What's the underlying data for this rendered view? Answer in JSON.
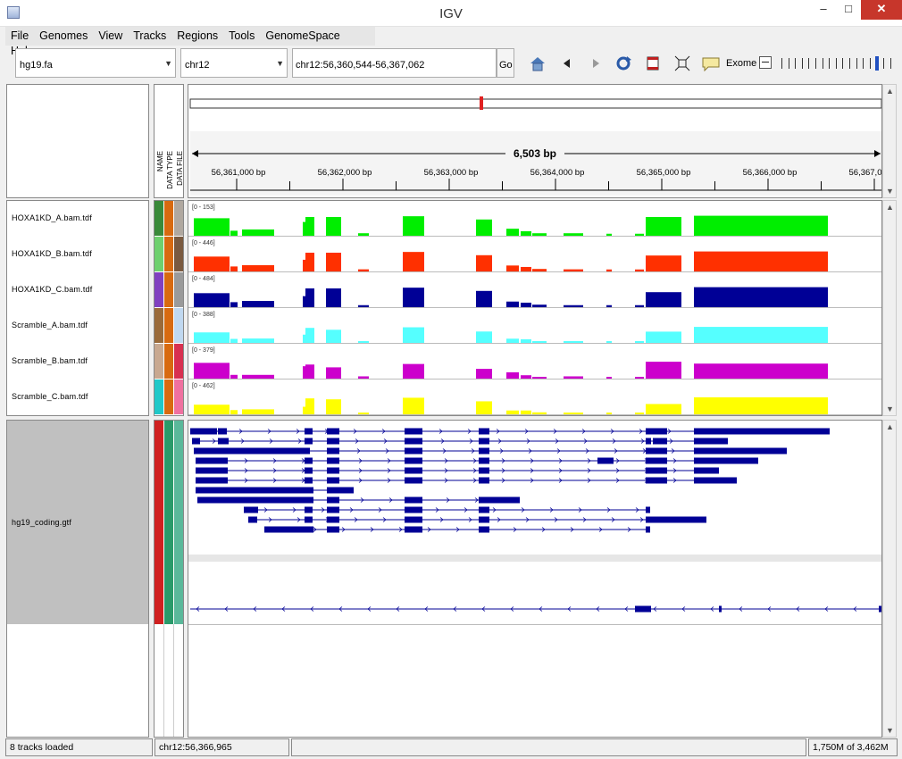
{
  "window": {
    "title": "IGV",
    "minimize": "–",
    "maximize": "□",
    "close": "✕"
  },
  "menu": [
    "File",
    "Genomes",
    "View",
    "Tracks",
    "Regions",
    "Tools",
    "GenomeSpace",
    "Help"
  ],
  "toolbar": {
    "genome": "hg19.fa",
    "chromosome": "chr12",
    "locus": "chr12:56,360,544-56,367,062",
    "go_label": "Go",
    "exome_label": "Exome",
    "zoom_level": 14,
    "zoom_max": 17,
    "icons": [
      "home-icon",
      "back-icon",
      "forward-icon",
      "refresh-icon",
      "ruler-icon",
      "region-select-icon",
      "popup-text-icon"
    ]
  },
  "ruler": {
    "span_label": "6,503 bp",
    "start": 56360544,
    "end": 56367062,
    "ticks": [
      "56,361,000 bp",
      "56,362,000 bp",
      "56,363,000 bp",
      "56,364,000 bp",
      "56,365,000 bp",
      "56,366,000 bp",
      "56,367,0"
    ]
  },
  "attribute_headers": [
    "NAME",
    "DATA TYPE",
    "DATA FILE"
  ],
  "tracks": [
    {
      "name": "HOXA1KD_A.bam.tdf",
      "range": "[0 - 153]",
      "color": "#00ee00",
      "attr_colors": [
        "#3a8a3a",
        "#d86a10",
        "#b0a8a0"
      ]
    },
    {
      "name": "HOXA1KD_B.bam.tdf",
      "range": "[0 - 446]",
      "color": "#ff3000",
      "attr_colors": [
        "#6ed06e",
        "#d86a10",
        "#7a5a40"
      ]
    },
    {
      "name": "HOXA1KD_C.bam.tdf",
      "range": "[0 - 484]",
      "color": "#000096",
      "attr_colors": [
        "#8040c0",
        "#d86a10",
        "#9a9a9a"
      ]
    },
    {
      "name": "Scramble_A.bam.tdf",
      "range": "[0 - 388]",
      "color": "#55ffff",
      "attr_colors": [
        "#9a6a3a",
        "#d86a10",
        "#c0d8f0"
      ]
    },
    {
      "name": "Scramble_B.bam.tdf",
      "range": "[0 - 379]",
      "color": "#cc00cc",
      "attr_colors": [
        "#c8a890",
        "#d86a10",
        "#d83050"
      ]
    },
    {
      "name": "Scramble_C.bam.tdf",
      "range": "[0 - 462]",
      "color": "#ffff00",
      "attr_colors": [
        "#20c8c8",
        "#d86a10",
        "#f070a0"
      ]
    }
  ],
  "feature_track": {
    "name": "hg19_coding.gtf",
    "color": "#000096",
    "attr_colors": [
      "#d02020",
      "#2a9a6a",
      "#5ab89a"
    ]
  },
  "status": {
    "tracks_loaded": "8 tracks loaded",
    "position": "chr12:56,366,965",
    "message": "",
    "memory": "1,750M of 3,462M"
  }
}
